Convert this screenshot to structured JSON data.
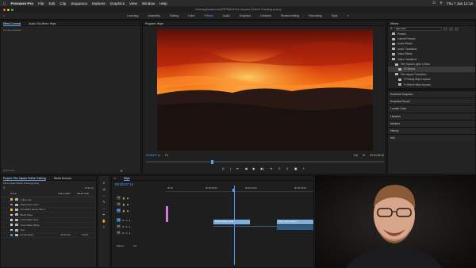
{
  "menubar": {
    "app": "Premiere Pro",
    "items": [
      "File",
      "Edit",
      "Clip",
      "Sequence",
      "Markers",
      "Graphics",
      "View",
      "Window",
      "Help"
    ],
    "clock": "Thu 7 Jan 12:18"
  },
  "window_title": "/Users/ghostmorris/PPWithFree Impact Online Training.prproj",
  "workspaces": {
    "items": [
      "Learning",
      "Assembly",
      "Editing",
      "Color",
      "Effects",
      "Audio",
      "Graphics",
      "Libraries",
      "Review editing",
      "Recording",
      "Style"
    ],
    "active_index": 4
  },
  "effect_controls": {
    "tabs": [
      "Effect Controls",
      "Audio Clip Mixer: Wipe"
    ],
    "empty_text": "(no clip selected)"
  },
  "program_monitor": {
    "title": "Program: Wipe",
    "timecode_left": "00:00:07:14",
    "fit": "Fit",
    "quality": "Full",
    "timecode_right": "00:00:05:00"
  },
  "effects_panel": {
    "title": "Effects",
    "search_value": "w|pe strip",
    "tree": [
      {
        "label": "Presets",
        "indent": 0
      },
      {
        "label": "Lumetri Presets",
        "indent": 0
      },
      {
        "label": "Audio Effects",
        "indent": 0
      },
      {
        "label": "Audio Transitions",
        "indent": 0
      },
      {
        "label": "Video Effects",
        "indent": 0
      },
      {
        "label": "Video Transitions",
        "indent": 0
      },
      {
        "label": "Film Impact Lights & Blurs",
        "indent": 1
      },
      {
        "label": "Fil Stripes",
        "indent": 2,
        "selected": true
      },
      {
        "label": "Film Impact Transitions",
        "indent": 1
      },
      {
        "label": "Fi Rolling Wipe Impacts",
        "indent": 2
      },
      {
        "label": "Fi Stretch Wipe Impacts",
        "indent": 2
      }
    ],
    "sections": [
      "Essential Graphics",
      "Essential Sound",
      "Lumetri Color",
      "Libraries",
      "Markers",
      "History",
      "Info"
    ]
  },
  "project_panel": {
    "tabs": [
      "Project: Film Impact Online Training",
      "Media Browser"
    ],
    "project_file": "Film Impact Online Training.prproj",
    "item_count": "13 Items",
    "columns": [
      "Name",
      "Frame Rate",
      "Media Start"
    ],
    "items": [
      {
        "name": "1 files now",
        "color": "#e8b34a",
        "rate": "",
        "start": ""
      },
      {
        "name": "Adjustment Layer",
        "color": "#b67ad1",
        "rate": "",
        "start": ""
      },
      {
        "name": "Animation Series Part 1",
        "color": "#e8b34a",
        "rate": "",
        "start": ""
      },
      {
        "name": "Black Video",
        "color": "#cfcfcf",
        "rate": "",
        "start": ""
      },
      {
        "name": "Color Matte Gray",
        "color": "#cfcfcf",
        "rate": "",
        "start": ""
      },
      {
        "name": "Color Matte White",
        "color": "#cfcfcf",
        "rate": "",
        "start": ""
      },
      {
        "name": "Text",
        "color": "#cfcfcf",
        "rate": "",
        "start": ""
      },
      {
        "name": "Introductions",
        "color": "#4c8bd6",
        "rate": "29,97 fps",
        "start": "00:00"
      }
    ]
  },
  "timeline": {
    "tab": "Wipe",
    "timecode": "00:00:07:14",
    "ruler": [
      "00:00",
      "00:00:05:00",
      "00:00:10:00",
      "00:00:15:00"
    ],
    "video_tracks": [
      "V3",
      "V2",
      "V1"
    ],
    "audio_tracks": [
      "A1",
      "A2",
      "A3"
    ],
    "master": "Master",
    "master_value": "0,0",
    "clips": [
      {
        "track": "V1",
        "label": "Sunset",
        "extra": "sunset_clock",
        "color": "#7faed9"
      },
      {
        "track": "V1",
        "label": "Time_lapse",
        "extra": "sunset_1",
        "color": "#7faed9"
      }
    ]
  },
  "colors": {
    "accent": "#4fa3ff",
    "playhead": "#4fa3ff",
    "clip_video": "#7faed9",
    "clip_adjust": "#d37bd4"
  }
}
